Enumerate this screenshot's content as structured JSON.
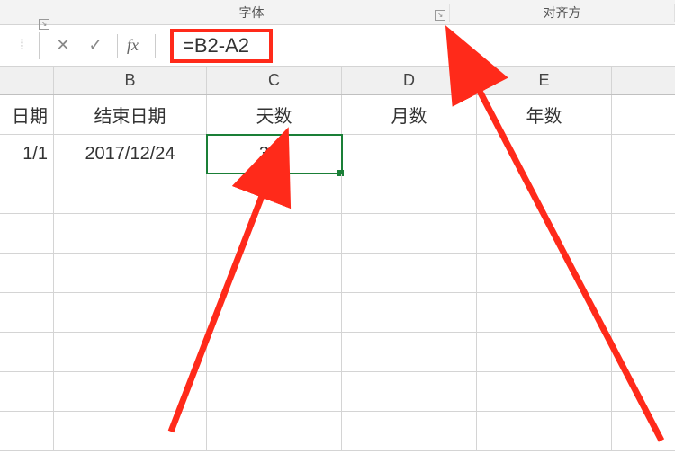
{
  "ribbon": {
    "font_label": "字体",
    "align_label": "对齐方"
  },
  "formula_bar": {
    "fx_label": "fx",
    "formula": "=B2-A2"
  },
  "columns": {
    "b": "B",
    "c": "C",
    "d": "D",
    "e": "E"
  },
  "headers": {
    "a_partial": "日期",
    "b": "结束日期",
    "c": "天数",
    "d": "月数",
    "e": "年数"
  },
  "row2": {
    "a_partial": "1/1",
    "b": "2017/12/24",
    "c": "357",
    "d": "",
    "e": ""
  },
  "icons": {
    "cancel": "✕",
    "confirm": "✓",
    "launcher": "↘",
    "dots": "⁞"
  }
}
